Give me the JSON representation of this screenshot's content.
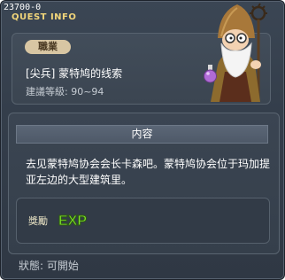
{
  "window": {
    "quest_id": "23700-0",
    "title": "QUEST INFO"
  },
  "header": {
    "job_tag": "職業",
    "quest_name": "[尖兵] 蒙特鸠的线索",
    "level_label": "建議等級: 90~94"
  },
  "content": {
    "header": "内容",
    "text": "去见蒙特鸠协会会长卡森吧。蒙特鸠协会位于玛加提亚左边的大型建筑里。"
  },
  "reward": {
    "label": "獎勵",
    "exp_text": "EXP"
  },
  "status": "狀態: 可開始",
  "colors": {
    "window_bg": "#343e4b",
    "title": "#f1d57a",
    "job_tag_bg": "#d8c6a3",
    "exp_green": "#7ee02c"
  },
  "icons": {
    "npc": "wizard-npc-portrait",
    "reward": "exp-icon"
  }
}
